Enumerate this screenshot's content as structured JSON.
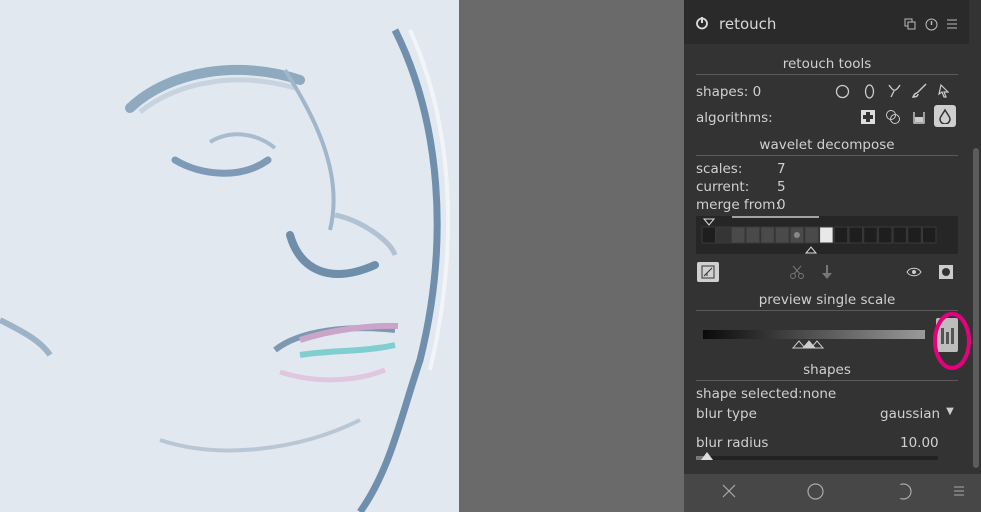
{
  "module": {
    "title": "retouch"
  },
  "sections": {
    "retouch_tools": "retouch tools",
    "wavelet_decompose": "wavelet decompose",
    "preview_single_scale": "preview single scale",
    "shapes": "shapes"
  },
  "shapes_row": {
    "label": "shapes: 0"
  },
  "algorithms_row": {
    "label": "algorithms:"
  },
  "wavelet": {
    "scales_label": "scales:",
    "scales_value": "7",
    "current_label": "current:",
    "current_value": "5",
    "merge_label": "merge from:",
    "merge_value": "0"
  },
  "shapes_section": {
    "selected": "shape selected:none",
    "blur_type_label": "blur type",
    "blur_type_value": "gaussian",
    "blur_radius_label": "blur radius",
    "blur_radius_value": "10.00"
  },
  "colors": {
    "panel": "#333333",
    "header": "#2a2a2a",
    "highlight_circle": "#e6007e"
  }
}
